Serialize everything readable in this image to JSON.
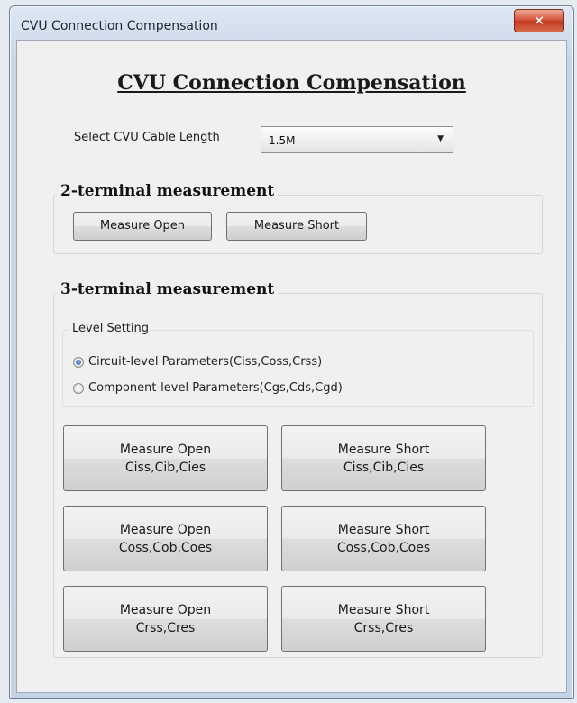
{
  "window": {
    "title": "CVU Connection Compensation",
    "close_icon": "close-icon"
  },
  "main": {
    "heading": "CVU Connection Compensation",
    "cable_length": {
      "label": "Select CVU Cable Length",
      "selected": "1.5M"
    }
  },
  "two_terminal": {
    "title": "2-terminal measurement",
    "measure_open": "Measure Open",
    "measure_short": "Measure Short"
  },
  "three_terminal": {
    "title": "3-terminal measurement",
    "level_setting": {
      "title": "Level Setting",
      "options": [
        {
          "label": "Circuit-level Parameters(Ciss,Coss,Crss)",
          "checked": true
        },
        {
          "label": "Component-level Parameters(Cgs,Cds,Cgd)",
          "checked": false
        }
      ]
    },
    "buttons": [
      {
        "line1": "Measure Open",
        "line2": "Ciss,Cib,Cies"
      },
      {
        "line1": "Measure Short",
        "line2": "Ciss,Cib,Cies"
      },
      {
        "line1": "Measure Open",
        "line2": "Coss,Cob,Coes"
      },
      {
        "line1": "Measure Short",
        "line2": "Coss,Cob,Coes"
      },
      {
        "line1": "Measure Open",
        "line2": "Crss,Cres"
      },
      {
        "line1": "Measure Short",
        "line2": "Crss,Cres"
      }
    ]
  },
  "colors": {
    "close_button": "#c9452a",
    "radio_selected": "#1e5ea8"
  }
}
